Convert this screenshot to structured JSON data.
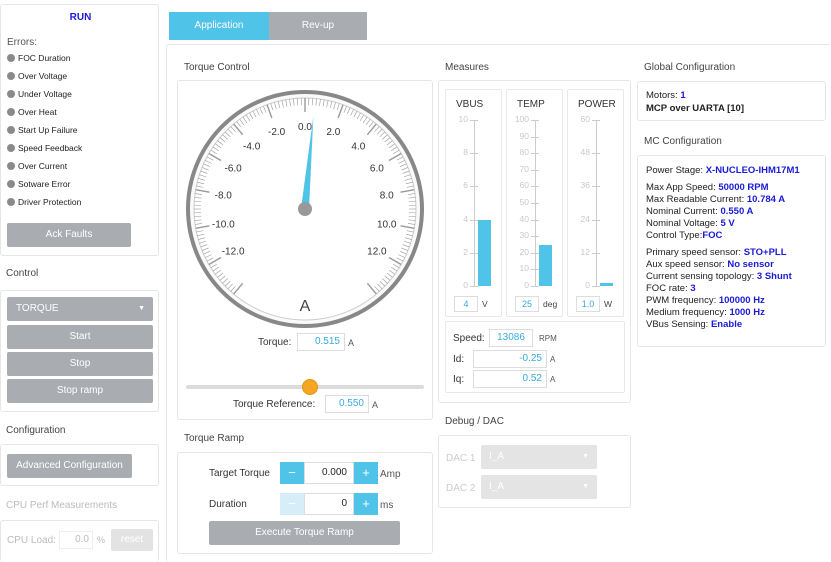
{
  "state": "RUN",
  "errors": {
    "title": "Errors:",
    "items": [
      "FOC Duration",
      "Over Voltage",
      "Under Voltage",
      "Over Heat",
      "Start Up Failure",
      "Speed Feedback",
      "Over Current",
      "Sotware Error",
      "Driver Protection"
    ],
    "ack_button": "Ack Faults"
  },
  "control": {
    "title": "Control",
    "mode": "TORQUE",
    "start": "Start",
    "stop": "Stop",
    "stop_ramp": "Stop ramp"
  },
  "configuration": {
    "title": "Configuration",
    "advanced_button": "Advanced Configuration"
  },
  "cpu": {
    "title": "CPU Perf Measurements",
    "load_label": "CPU Load:",
    "load_value": "0.0",
    "load_unit": "%",
    "reset_button": "reset"
  },
  "tabs": [
    {
      "label": "Application",
      "active": true
    },
    {
      "label": "Rev-up",
      "active": false
    }
  ],
  "torque_control": {
    "title": "Torque Control",
    "gauge": {
      "min": -14,
      "max": 14,
      "value": 0.515,
      "tick_labels": [
        "-12.0",
        "-10.0",
        "-8.0",
        "-6.0",
        "-4.0",
        "-2.0",
        "0.0",
        "2.0",
        "4.0",
        "6.0",
        "8.0",
        "10.0",
        "12.0"
      ],
      "unit": "A"
    },
    "torque_label": "Torque:",
    "torque_value": "0.515",
    "torque_unit": "A",
    "slider_fraction": 0.52,
    "reference_label": "Torque Reference:",
    "reference_value": "0.550",
    "reference_unit": "A"
  },
  "torque_ramp": {
    "title": "Torque Ramp",
    "target_label": "Target Torque",
    "target_value": "0.000",
    "target_unit": "Amp",
    "duration_label": "Duration",
    "duration_value": "0",
    "duration_unit": "ms",
    "minus": "−",
    "plus": "+",
    "execute_button": "Execute Torque Ramp"
  },
  "measures": {
    "title": "Measures",
    "bars": [
      {
        "label": "VBUS",
        "max": 10,
        "value": 4,
        "ticks": [
          "10",
          "8",
          "6",
          "4",
          "2",
          "0"
        ],
        "readout": "4",
        "unit": "V"
      },
      {
        "label": "TEMP",
        "max": 100,
        "value": 25,
        "ticks": [
          "100",
          "90",
          "80",
          "70",
          "60",
          "50",
          "40",
          "30",
          "20",
          "10",
          "0"
        ],
        "readout": "25",
        "unit": "deg"
      },
      {
        "label": "POWER",
        "max": 60,
        "value": 1,
        "ticks": [
          "60",
          "48",
          "36",
          "24",
          "12",
          "0"
        ],
        "readout": "1.0",
        "unit": "W"
      }
    ],
    "speed_label": "Speed:",
    "speed_value": "13086",
    "speed_unit": "RPM",
    "id_label": "Id:",
    "id_value": "-0.25",
    "id_unit": "A",
    "iq_label": "Iq:",
    "iq_value": "0.52",
    "iq_unit": "A"
  },
  "debug": {
    "title": "Debug / DAC",
    "dac1_label": "DAC 1",
    "dac1_value": "I_A",
    "dac2_label": "DAC 2",
    "dac2_value": "I_A"
  },
  "global_config": {
    "title": "Global Configuration",
    "motors_label": "Motors:",
    "motors_value": "1",
    "protocol": "MCP over UARTA [10]"
  },
  "mc_config": {
    "title": "MC Configuration",
    "lines": [
      {
        "label": "Power Stage:",
        "value": "X-NUCLEO-IHM17M1"
      },
      {
        "label": "Max App Speed:",
        "value": "50000 RPM"
      },
      {
        "label": "Max Readable Current:",
        "value": "10.784 A"
      },
      {
        "label": "Nominal Current:",
        "value": "0.550 A"
      },
      {
        "label": "Nominal Voltage:",
        "value": "5 V"
      },
      {
        "label": "Control Type:",
        "value": "FOC"
      },
      {
        "label": "Primary speed sensor:",
        "value": "STO+PLL"
      },
      {
        "label": "Aux speed sensor:",
        "value": "No sensor"
      },
      {
        "label": "Current sensing topology:",
        "value": "3 Shunt"
      },
      {
        "label": "FOC rate:",
        "value": "3"
      },
      {
        "label": "PWM frequency:",
        "value": "100000 Hz"
      },
      {
        "label": "Medium frequency:",
        "value": "1000 Hz"
      },
      {
        "label": "VBus Sensing:",
        "value": "Enable"
      }
    ]
  },
  "colors": {
    "accent": "#4fc3e8",
    "button_gray": "#a9acb0",
    "orange": "#f5a623",
    "value_blue": "#1a1ad8"
  }
}
